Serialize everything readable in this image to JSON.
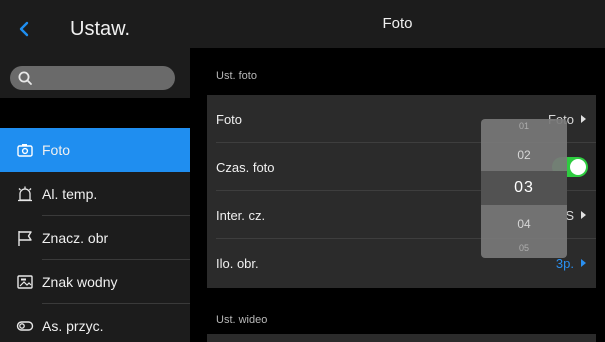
{
  "sidebar": {
    "title": "Ustaw.",
    "search_placeholder": "",
    "items": [
      {
        "label": "Foto",
        "icon": "camera-icon",
        "active": true
      },
      {
        "label": "Al. temp.",
        "icon": "alarm-clock-icon",
        "active": false
      },
      {
        "label": "Znacz. obr",
        "icon": "flag-icon",
        "active": false
      },
      {
        "label": "Znak wodny",
        "icon": "image-icon",
        "active": false
      },
      {
        "label": "As. przyc.",
        "icon": "toggle-icon",
        "active": false
      }
    ]
  },
  "main": {
    "title": "Foto",
    "section_photo": "Ust. foto",
    "section_video": "Ust. wideo",
    "rows": [
      {
        "label": "Foto",
        "value": "Foto"
      },
      {
        "label": "Czas. foto",
        "toggle_on": true
      },
      {
        "label": "Inter. cz.",
        "value": "S"
      },
      {
        "label": "Ilo. obr.",
        "value": "3p."
      }
    ]
  },
  "picker": {
    "options": [
      "01",
      "02",
      "03",
      "04",
      "05"
    ],
    "selected": "03"
  },
  "colors": {
    "accent": "#1f8ef0",
    "toggle_on": "#2ecc40",
    "panel": "#2b2b2b"
  }
}
